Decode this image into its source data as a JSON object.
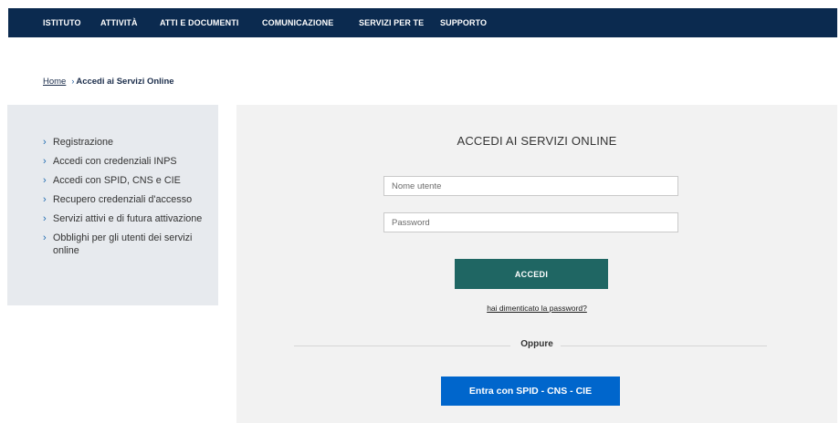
{
  "nav": {
    "items": [
      {
        "label": "ISTITUTO"
      },
      {
        "label": "ATTIVITÀ"
      },
      {
        "label": "ATTI E DOCUMENTI"
      },
      {
        "label": "COMUNICAZIONE"
      },
      {
        "label": "SERVIZI PER TE"
      },
      {
        "label": "SUPPORTO"
      }
    ]
  },
  "breadcrumb": {
    "home": "Home",
    "separator": "›",
    "current": "Accedi ai Servizi Online"
  },
  "sidebar": {
    "chevron": "›",
    "items": [
      {
        "label": "Registrazione"
      },
      {
        "label": "Accedi con credenziali INPS"
      },
      {
        "label": "Accedi con SPID, CNS e CIE"
      },
      {
        "label": "Recupero credenziali d'accesso"
      },
      {
        "label": "Servizi attivi e di futura attivazione"
      },
      {
        "label": "Obblighi per gli utenti dei servizi online"
      }
    ]
  },
  "login": {
    "title": "ACCEDI AI SERVIZI ONLINE",
    "username": {
      "value": "",
      "placeholder": "Nome utente"
    },
    "password": {
      "value": "",
      "placeholder": "Password"
    },
    "submit_label": "ACCEDI",
    "forgot_label": "hai dimenticato la password?",
    "divider_label": "Oppure",
    "spid_label": "Entra con SPID - CNS - CIE"
  },
  "colors": {
    "nav_background": "#0b2a4f",
    "submit_button": "#1f6663",
    "spid_button": "#0066cc",
    "sidebar_background": "#e7eaee",
    "panel_background": "#f2f2f2",
    "link_accent": "#1f6bb0"
  }
}
